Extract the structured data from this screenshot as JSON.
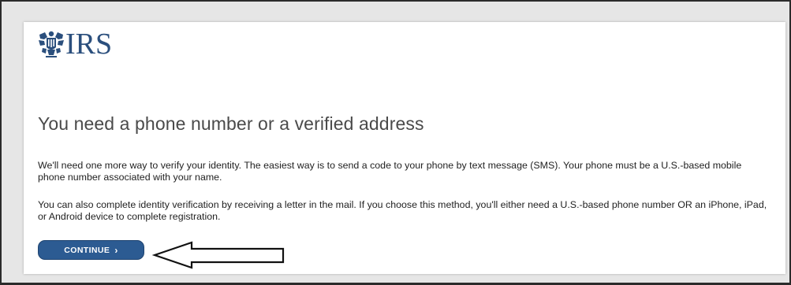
{
  "logo": {
    "text": "IRS",
    "icon": "irs-eagle-logo-icon",
    "color": "#2b4f7d"
  },
  "page": {
    "heading": "You need a phone number or a verified address",
    "paragraph1": "We'll need one more way to verify your identity. The easiest way is to send a code to your phone by text message (SMS). Your phone must be a U.S.-based mobile phone number associated with your name.",
    "paragraph2": "You can also complete identity verification by receiving a letter in the mail. If you choose this method, you'll either need a U.S.-based phone number OR an iPhone, iPad, or Android device to complete registration."
  },
  "continue_button": {
    "label": "CONTINUE",
    "chevron": "›",
    "icon": "chevron-right-icon",
    "color": "#2c5b92"
  },
  "annotation": {
    "icon": "left-arrow-icon"
  }
}
